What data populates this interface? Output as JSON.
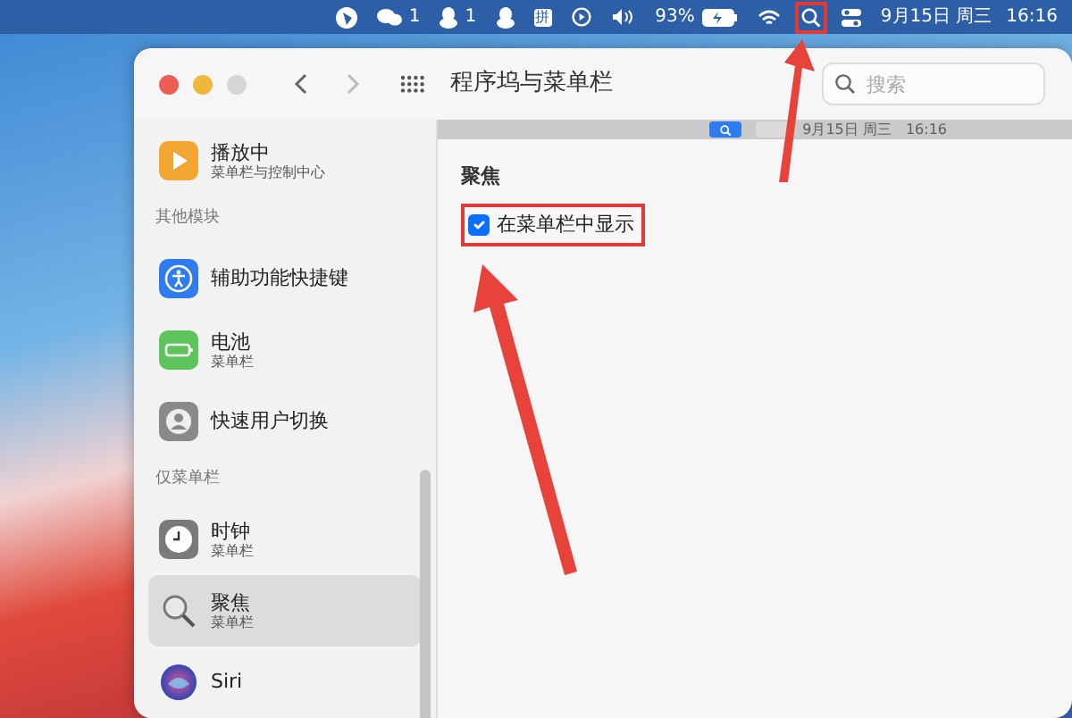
{
  "menu_bar": {
    "wechat_count": "1",
    "qq_count": "1",
    "input_method": "拼",
    "battery_percent": "93%",
    "search_highlighted": true,
    "date": "9月15日 周三",
    "time": "16:16"
  },
  "window": {
    "title": "程序坞与菜单栏",
    "search_placeholder": "搜索",
    "sidebar": [
      {
        "kind": "item",
        "title": "播放中",
        "subtitle": "菜单栏与控制中心",
        "selected": false
      },
      {
        "kind": "header",
        "text": "其他模块"
      },
      {
        "kind": "item",
        "title": "辅助功能快捷键",
        "selected": false
      },
      {
        "kind": "item",
        "title": "电池",
        "subtitle": "菜单栏",
        "selected": false
      },
      {
        "kind": "item",
        "title": "快速用户切换",
        "selected": false
      },
      {
        "kind": "header",
        "text": "仅菜单栏"
      },
      {
        "kind": "item",
        "title": "时钟",
        "subtitle": "菜单栏",
        "selected": false
      },
      {
        "kind": "item",
        "title": "聚焦",
        "subtitle": "菜单栏",
        "selected": true
      },
      {
        "kind": "item",
        "title": "Siri",
        "selected": false
      }
    ],
    "content": {
      "preview": {
        "date": "9月15日 周三",
        "time": "16:16"
      },
      "section_title": "聚焦",
      "option": {
        "label": "在菜单栏中显示",
        "checked": true,
        "highlighted": true
      }
    }
  }
}
